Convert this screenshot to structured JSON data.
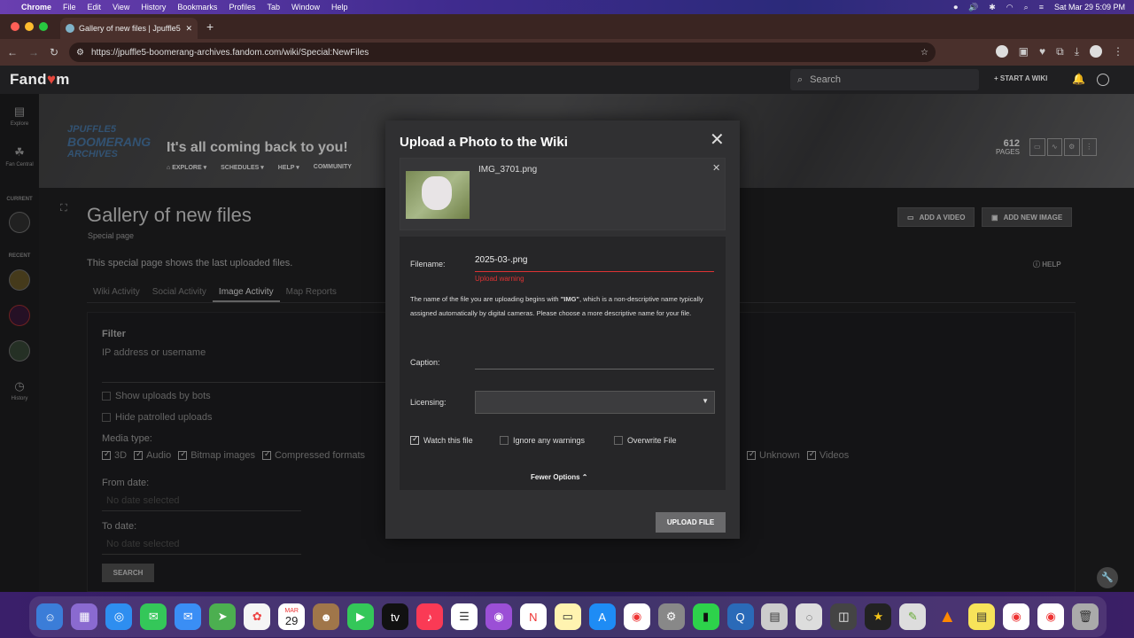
{
  "menubar": {
    "apple_glyph": "",
    "app": "Chrome",
    "items": [
      "File",
      "Edit",
      "View",
      "History",
      "Bookmarks",
      "Profiles",
      "Tab",
      "Window",
      "Help"
    ],
    "datetime": "Sat Mar 29  5:09 PM"
  },
  "browser": {
    "tab_title": "Gallery of new files | Jpuffle5",
    "url": "https://jpuffle5-boomerang-archives.fandom.com/wiki/Special:NewFiles"
  },
  "fandom": {
    "logo_text_a": "Fand",
    "logo_text_b": "m",
    "search_placeholder": "Search",
    "start_wiki": "START A WIKI"
  },
  "rail": {
    "explore": "Explore",
    "fan_central": "Fan Central",
    "current": "CURRENT",
    "recent": "RECENT",
    "history": "History"
  },
  "wiki": {
    "logo_lines": [
      "JPUFFLE5",
      "BOOMERANG",
      "ARCHIVES"
    ],
    "tagline": "It's all coming back to you!",
    "nav": [
      "EXPLORE",
      "SCHEDULES",
      "HELP",
      "COMMUNITY"
    ],
    "pages_count": "612",
    "pages_label": "PAGES"
  },
  "page": {
    "title": "Gallery of new files",
    "subtitle": "Special page",
    "add_video": "ADD A VIDEO",
    "add_image": "ADD NEW IMAGE",
    "help": "HELP",
    "intro": "This special page shows the last uploaded files.",
    "tabs": [
      "Wiki Activity",
      "Social Activity",
      "Image Activity",
      "Map Reports"
    ],
    "filter_title": "Filter",
    "ip_placeholder": "IP address or username",
    "show_bots": "Show uploads by bots",
    "hide_patrolled": "Hide patrolled uploads",
    "media_type_label": "Media type:",
    "media_types": [
      "3D",
      "Audio",
      "Bitmap images",
      "Compressed formats"
    ],
    "media_types_right": [
      "Unknown",
      "Videos"
    ],
    "from_date": "From date:",
    "to_date": "To date:",
    "no_date": "No date selected",
    "search_btn": "SEARCH"
  },
  "modal": {
    "title": "Upload a Photo to the Wiki",
    "file_name": "IMG_3701.png",
    "filename_label": "Filename:",
    "filename_value": "2025-03-.png",
    "upload_warning": "Upload warning",
    "warning_text_a": "The name of the file you are uploading begins with ",
    "warning_text_b": "\"IMG\"",
    "warning_text_c": ", which is a non-descriptive name typically assigned automatically by digital cameras. Please choose a more descriptive name for your file.",
    "caption_label": "Caption:",
    "licensing_label": "Licensing:",
    "watch": "Watch this file",
    "ignore": "Ignore any warnings",
    "overwrite": "Overwrite File",
    "fewer_options": "Fewer Options",
    "upload_btn": "UPLOAD FILE"
  },
  "dock": {
    "calendar_month": "MAR",
    "calendar_day": "29"
  }
}
